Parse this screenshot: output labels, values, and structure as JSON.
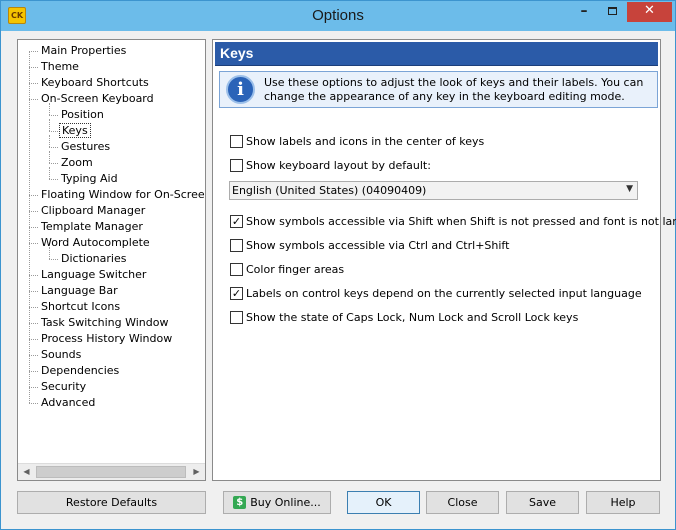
{
  "window": {
    "title": "Options",
    "app_icon_text": "CK"
  },
  "tree": {
    "items": [
      {
        "label": "Main Properties",
        "level": 0
      },
      {
        "label": "Theme",
        "level": 0
      },
      {
        "label": "Keyboard Shortcuts",
        "level": 0
      },
      {
        "label": "On-Screen Keyboard",
        "level": 0
      },
      {
        "label": "Position",
        "level": 1
      },
      {
        "label": "Keys",
        "level": 1,
        "selected": true
      },
      {
        "label": "Gestures",
        "level": 1
      },
      {
        "label": "Zoom",
        "level": 1
      },
      {
        "label": "Typing Aid",
        "level": 1
      },
      {
        "label": "Floating Window for On-Screen Ke",
        "level": 0
      },
      {
        "label": "Clipboard Manager",
        "level": 0
      },
      {
        "label": "Template Manager",
        "level": 0
      },
      {
        "label": "Word Autocomplete",
        "level": 0
      },
      {
        "label": "Dictionaries",
        "level": 1
      },
      {
        "label": "Language Switcher",
        "level": 0
      },
      {
        "label": "Language Bar",
        "level": 0
      },
      {
        "label": "Shortcut Icons",
        "level": 0
      },
      {
        "label": "Task Switching Window",
        "level": 0
      },
      {
        "label": "Process History Window",
        "level": 0
      },
      {
        "label": "Sounds",
        "level": 0
      },
      {
        "label": "Dependencies",
        "level": 0
      },
      {
        "label": "Security",
        "level": 0
      },
      {
        "label": "Advanced",
        "level": 0
      }
    ]
  },
  "panel": {
    "title": "Keys",
    "info_icon": "info-icon",
    "info_text": "Use these options to adjust the look of keys and their labels. You can change the appearance of any key in the keyboard editing mode.",
    "options": [
      {
        "label": "Show labels and icons in the center of keys",
        "checked": false
      },
      {
        "label": "Show keyboard layout by default:",
        "checked": false
      },
      {
        "label": "Show symbols accessible via Shift when Shift is not pressed and font is not large",
        "checked": true
      },
      {
        "label": "Show symbols accessible via Ctrl and Ctrl+Shift",
        "checked": false
      },
      {
        "label": "Color finger areas",
        "checked": false
      },
      {
        "label": "Labels on control keys depend on the currently selected input language",
        "checked": true
      },
      {
        "label": "Show the state of Caps Lock, Num Lock and Scroll Lock keys",
        "checked": false
      }
    ],
    "layout_select": {
      "value": "English (United States) (04090409)"
    }
  },
  "buttons": {
    "restore": "Restore Defaults",
    "buy": "Buy Online...",
    "ok": "OK",
    "close": "Close",
    "save": "Save",
    "help": "Help"
  },
  "colors": {
    "title_bar": "#6cbcea",
    "panel_header": "#2b5ba8",
    "close_button": "#c7433b",
    "buy_icon": "#34a853"
  }
}
